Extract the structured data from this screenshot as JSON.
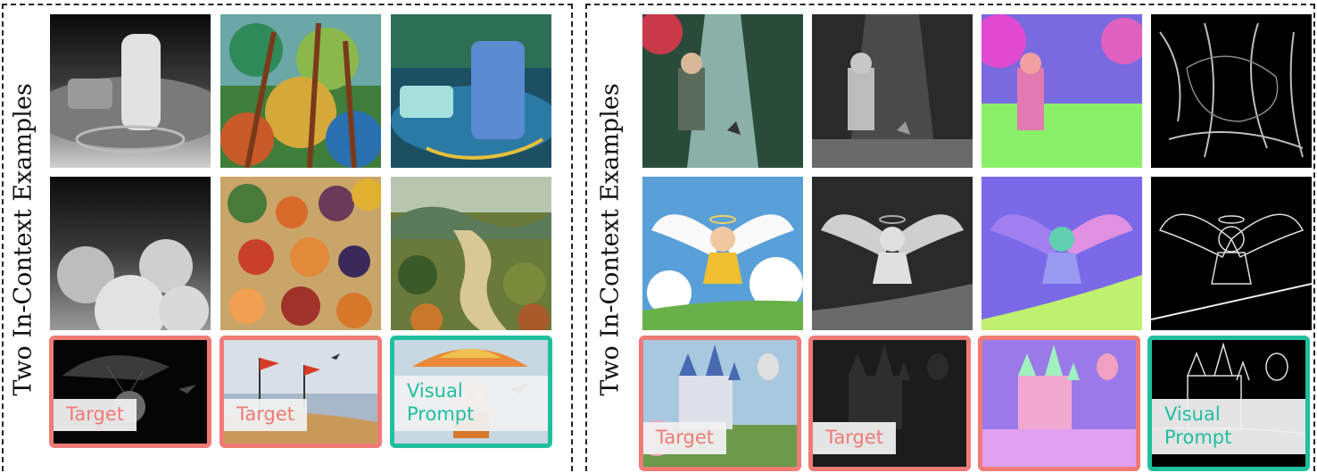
{
  "left_panel": {
    "side_label": "Two In-Context Examples",
    "rows": [
      [
        "depth-powerbank-image",
        "painted-forest-image",
        "powerbank-painting-image"
      ],
      [
        "depth-clouds-image",
        "painted-fruits-image",
        "painted-river-valley-image"
      ]
    ],
    "query": [
      {
        "image": "depth-parachute-image",
        "tag": "Target",
        "frame": "target"
      },
      {
        "image": "painted-flags-seaside-image",
        "tag": "Target",
        "frame": "target"
      },
      {
        "image": "parachute-kid-image",
        "tag": "Visual Prompt",
        "frame": "prompt"
      }
    ]
  },
  "right_panel": {
    "side_label": "Two In-Context Examples",
    "rows": [
      [
        "forest-boy-dog-image",
        "depth-forest-boy-image",
        "normal-forest-boy-image",
        "edge-forest-image"
      ],
      [
        "flying-angel-girl-image",
        "depth-angel-image",
        "normal-angel-image",
        "edge-angel-image"
      ]
    ],
    "query": [
      {
        "image": "fairy-castle-balloons-image",
        "tag": "Target",
        "frame": "target"
      },
      {
        "image": "depth-castle-image",
        "tag": "Target",
        "frame": "target"
      },
      {
        "image": "normal-castle-image",
        "tag": "Target",
        "frame": "target"
      },
      {
        "image": "edge-castle-image",
        "tag": "Visual Prompt",
        "frame": "prompt"
      }
    ]
  },
  "colors": {
    "target_frame": "#ee7b75",
    "prompt_frame": "#1fbfa0"
  }
}
